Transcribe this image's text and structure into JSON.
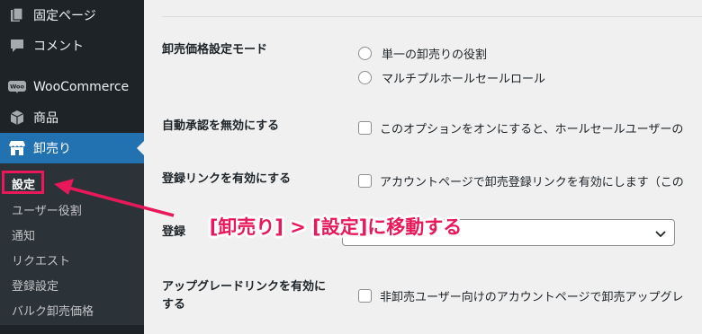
{
  "sidebar": {
    "items": [
      {
        "label": "固定ページ",
        "icon": "page-icon"
      },
      {
        "label": "コメント",
        "icon": "comment-icon"
      },
      {
        "label": "WooCommerce",
        "icon": "woo-icon",
        "badge": "Woo"
      },
      {
        "label": "商品",
        "icon": "box-icon"
      },
      {
        "label": "卸売り",
        "icon": "store-icon",
        "active": true
      }
    ],
    "submenu": [
      {
        "label": "設定",
        "current": true
      },
      {
        "label": "ユーザー役割"
      },
      {
        "label": "通知"
      },
      {
        "label": "リクエスト"
      },
      {
        "label": "登録設定"
      },
      {
        "label": "バルク卸売価格"
      }
    ]
  },
  "settings": {
    "mode_label": "卸売価格設定モード",
    "mode_options": [
      "単一の卸売りの役割",
      "マルチプルホールセールロール"
    ],
    "autoapprove_label": "自動承認を無効にする",
    "autoapprove_text": "このオプションをオンにすると、ホールセールユーザーの",
    "reglink_label": "登録リンクを有効にする",
    "reglink_text": "アカウントページで卸売登録リンクを有効にします（この",
    "regpage_label": "登録",
    "upgrade_label_line1": "アップグレードリンクを有効に",
    "upgrade_label_line2": "する",
    "upgrade_text": "非卸売ユーザー向けのアカウントページで卸売アップグレ"
  },
  "annotation": {
    "text": "[卸売り] > [設定]に移動する",
    "color": "#e8185a"
  },
  "colors": {
    "sidebar_bg": "#1d2327",
    "submenu_bg": "#2c3338",
    "active_bg": "#2271b1",
    "highlight": "#e8185a"
  }
}
